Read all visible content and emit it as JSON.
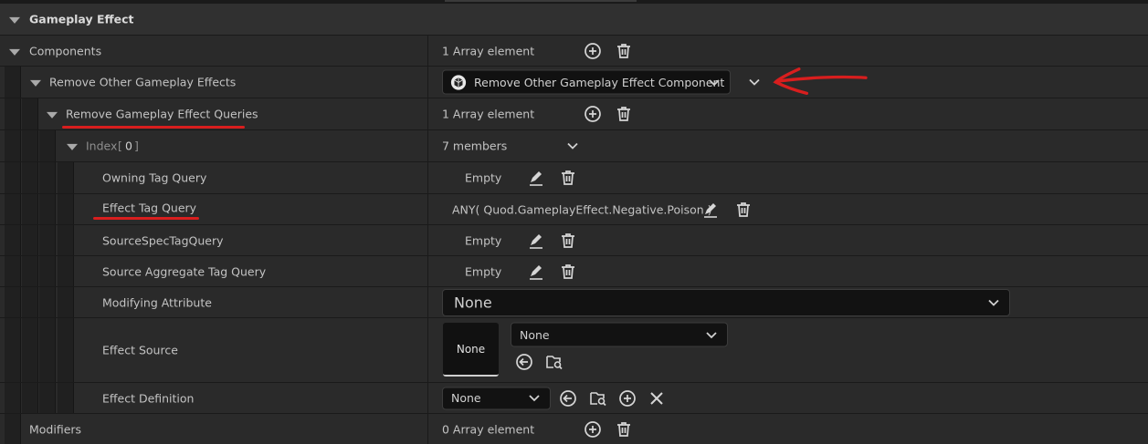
{
  "category": {
    "title": "Gameplay Effect"
  },
  "components": {
    "label": "Components",
    "value": "1 Array element"
  },
  "remove_other": {
    "label": "Remove Other Gameplay Effects",
    "dropdown_value": "Remove Other Gameplay Effect Component"
  },
  "remove_queries": {
    "label": "Remove Gameplay Effect Queries",
    "value": "1 Array element"
  },
  "index_row": {
    "label": "Index",
    "bracket_open": "[",
    "index": "0",
    "bracket_close": "]",
    "value": "7 members"
  },
  "owning_tag_query": {
    "label": "Owning Tag Query",
    "value": "Empty"
  },
  "effect_tag_query": {
    "label": "Effect Tag Query",
    "value": "ANY( Quod.GameplayEffect.Negative.Poison )"
  },
  "source_spec_tag_query": {
    "label": "SourceSpecTagQuery",
    "value": "Empty"
  },
  "source_aggregate_tag_query": {
    "label": "Source Aggregate Tag Query",
    "value": "Empty"
  },
  "modifying_attribute": {
    "label": "Modifying Attribute",
    "value": "None"
  },
  "effect_source": {
    "label": "Effect Source",
    "thumbnail_text": "None",
    "dropdown_value": "None"
  },
  "effect_definition": {
    "label": "Effect Definition",
    "dropdown_value": "None"
  },
  "modifiers": {
    "label": "Modifiers",
    "value": "0 Array element"
  },
  "annotation": {
    "color": "#d81e1e"
  }
}
